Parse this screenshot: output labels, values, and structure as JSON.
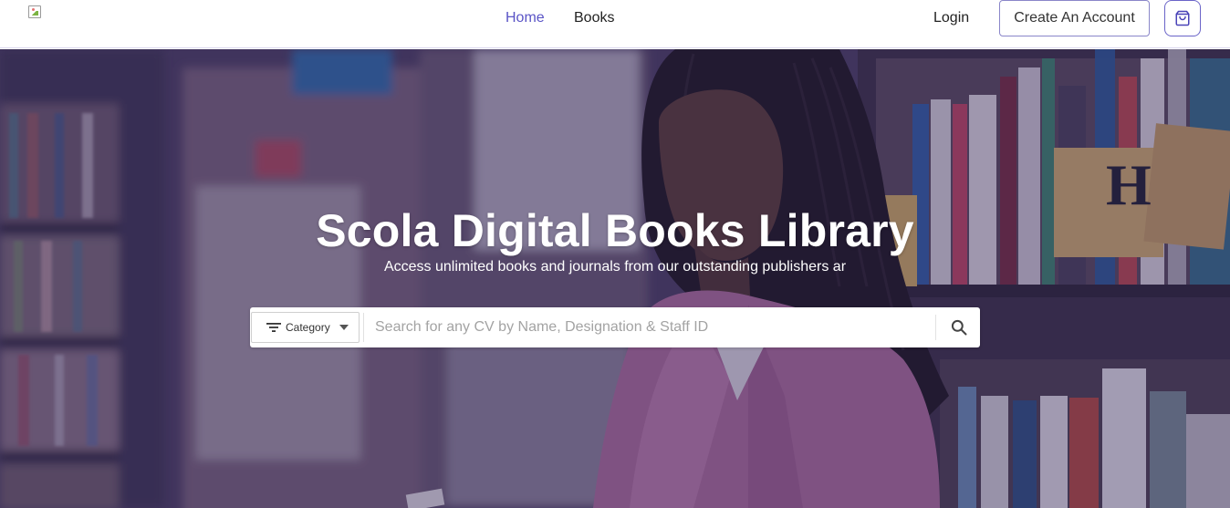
{
  "nav": {
    "logo_icon": "broken-image-icon",
    "home": "Home",
    "books": "Books",
    "login": "Login",
    "create_account": "Create An Account",
    "cart_icon": "shopping-bag-icon",
    "active_color": "#5a54c6"
  },
  "hero": {
    "title": "Scola Digital Books Library",
    "subtitle": "Access unlimited books and journals from our outstanding publishers ar",
    "overlay_color": "#30245c"
  },
  "search": {
    "category_label": "Category",
    "placeholder": "Search for any CV by Name, Designation & Staff ID",
    "value": "",
    "filter_icon": "filter-icon",
    "caret_icon": "caret-down-icon",
    "search_icon": "search-icon"
  }
}
